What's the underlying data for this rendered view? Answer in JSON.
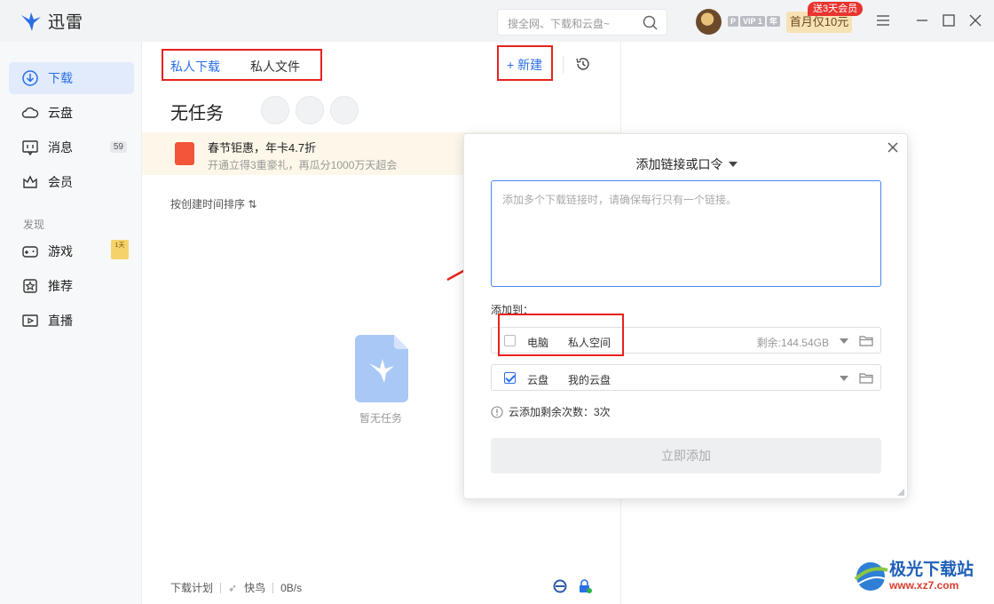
{
  "app": {
    "name": "迅雷"
  },
  "titlebar": {
    "search_placeholder": "搜全网、下载和云盘~",
    "vip_labels": [
      "P",
      "VIP 1",
      "年"
    ],
    "promo_label": "首月仅10元",
    "promo_badge": "送3天会员"
  },
  "sidebar": {
    "items": [
      {
        "label": "下载",
        "icon": "download-icon",
        "active": true
      },
      {
        "label": "云盘",
        "icon": "cloud-icon"
      },
      {
        "label": "消息",
        "icon": "message-icon",
        "count": "59"
      },
      {
        "label": "会员",
        "icon": "crown-icon"
      }
    ],
    "section_label": "发现",
    "discover": [
      {
        "label": "游戏",
        "icon": "gamepad-icon",
        "badge": "1天"
      },
      {
        "label": "推荐",
        "icon": "star-icon"
      },
      {
        "label": "直播",
        "icon": "live-icon"
      }
    ]
  },
  "main": {
    "tabs": [
      {
        "label": "私人下载",
        "active": true
      },
      {
        "label": "私人文件"
      }
    ],
    "new_button": "+ 新建",
    "title": "无任务",
    "banner": {
      "title": "春节钜惠，年卡4.7折",
      "subtitle": "开通立得3重豪礼，再瓜分1000万天超会"
    },
    "sort_label": "按创建时间排序 ⇅",
    "empty_text": "暂无任务",
    "footer": {
      "plan": "下载计划",
      "bird": "快鸟",
      "speed": "0B/s"
    }
  },
  "dialog": {
    "title": "添加链接或口令",
    "placeholder": "添加多个下载链接时，请确保每行只有一个链接。",
    "add_to_label": "添加到：",
    "destinations": [
      {
        "type": "电脑",
        "location": "私人空间",
        "free": "剩余:144.54GB",
        "checked": false
      },
      {
        "type": "云盘",
        "location": "我的云盘",
        "free": "",
        "checked": true
      }
    ],
    "quota_text": "云添加剩余次数：3次",
    "submit_label": "立即添加"
  },
  "watermark": {
    "title": "极光下载站",
    "url": "www.xz7.com"
  },
  "colors": {
    "accent": "#2a6fe8",
    "highlight": "#e8211c",
    "banner_bg": "#fdf7e9"
  }
}
